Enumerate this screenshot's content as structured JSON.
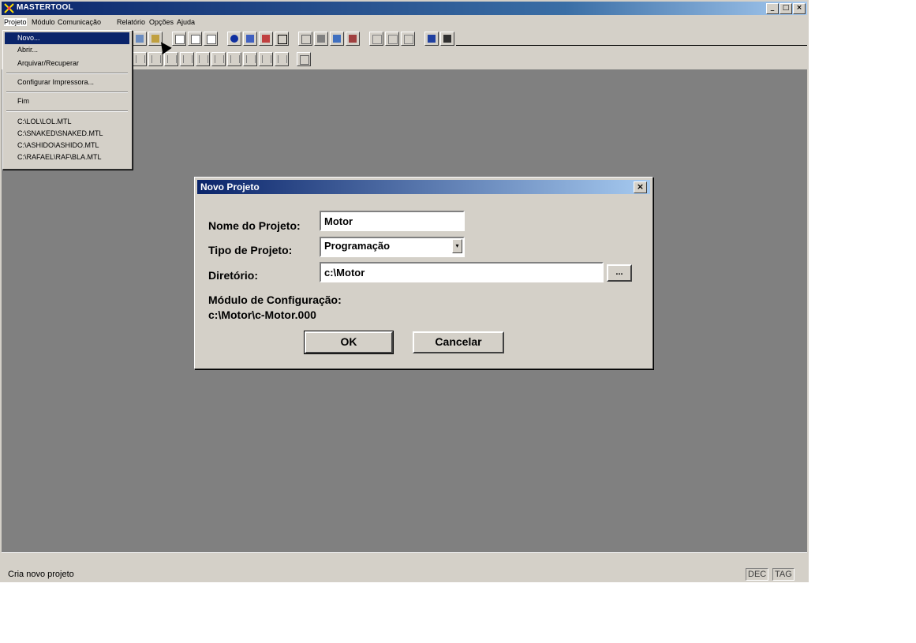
{
  "window": {
    "title": "MASTERTOOL",
    "controls": [
      "_",
      "□",
      "×"
    ]
  },
  "menubar": [
    "Projeto",
    "Módulo",
    "Comunicação",
    "Relatório",
    "Opções",
    "Ajuda"
  ],
  "dropdown": {
    "items": [
      "Novo...",
      "Abrir...",
      "Arquivar/Recuperar",
      "Configurar Impressora...",
      "Fim"
    ],
    "recent": [
      "C:\\LOL\\LOL.MTL",
      "C:\\SNAKED\\SNAKED.MTL",
      "C:\\ASHIDO\\ASHIDO.MTL",
      "C:\\RAFAEL\\RAF\\BLA.MTL"
    ]
  },
  "dialog": {
    "title": "Novo Projeto",
    "close": "×",
    "name_label": "Nome do Projeto:",
    "name_value": "Motor",
    "type_label": "Tipo de Projeto:",
    "type_value": "Programação",
    "dir_label": "Diretório:",
    "dir_value": "c:\\Motor",
    "browse": "...",
    "module_label": "Módulo de Configuração:",
    "module_value": "c:\\Motor\\c-Motor.000",
    "ok": "OK",
    "cancel": "Cancelar"
  },
  "status": {
    "text": "Cria novo projeto",
    "dec": "DEC",
    "tag": "TAG"
  }
}
